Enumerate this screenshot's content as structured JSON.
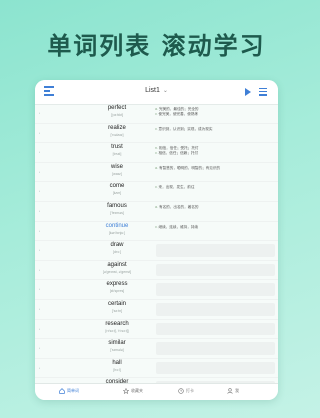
{
  "hero": {
    "title": "单词列表 滚动学习"
  },
  "toolbar": {
    "title": "List1",
    "chevron": "⌄"
  },
  "rows": [
    {
      "word": "perfect",
      "phonetic": "['pɜ:fɪkt]",
      "defs": [
        {
          "pos": "a.",
          "text": "完美的，最佳的；完全的"
        },
        {
          "pos": "v.",
          "text": "使完美，使完善，使熟练"
        }
      ]
    },
    {
      "word": "realize",
      "phonetic": "['rɪəlaɪz]",
      "defs": [
        {
          "pos": "v.",
          "text": "意识到，认识到；实现，成为现实"
        }
      ]
    },
    {
      "word": "trust",
      "phonetic": "[trʌst]",
      "defs": [
        {
          "pos": "n.",
          "text": "相信，信任；受托；托付"
        },
        {
          "pos": "v.",
          "text": "相信，信任；信赖；托付"
        }
      ]
    },
    {
      "word": "wise",
      "phonetic": "[waɪz]",
      "defs": [
        {
          "pos": "a.",
          "text": "有智慧的，聪明的，明智的；有见识的"
        }
      ]
    },
    {
      "word": "come",
      "phonetic": "[kʌm]",
      "defs": [
        {
          "pos": "v.",
          "text": "来，出现，发生，前往"
        }
      ]
    },
    {
      "word": "famous",
      "phonetic": "['feɪməs]",
      "defs": [
        {
          "pos": "a.",
          "text": "有名的，出名的，著名的"
        }
      ]
    },
    {
      "word": "continue",
      "phonetic": "[kən'tɪnju:]",
      "active": true,
      "defs": [
        {
          "pos": "v.",
          "text": "继续，连续，维持，持续"
        }
      ]
    },
    {
      "word": "draw",
      "phonetic": "[drɔ:]",
      "defs": []
    },
    {
      "word": "against",
      "phonetic": "[ə'geɪnst, ə'genst]",
      "defs": []
    },
    {
      "word": "express",
      "phonetic": "[ɪk'spres]",
      "defs": []
    },
    {
      "word": "certain",
      "phonetic": "['sɜ:tn]",
      "defs": []
    },
    {
      "word": "research",
      "phonetic": "[rɪ'sɜ:tʃ, 'ri:sɜ:tʃ]",
      "defs": []
    },
    {
      "word": "similar",
      "phonetic": "['sɪmələ]",
      "defs": []
    },
    {
      "word": "hall",
      "phonetic": "[hɔ:l]",
      "defs": []
    },
    {
      "word": "consider",
      "phonetic": "[kən'sɪdə]",
      "defs": []
    }
  ],
  "tabbar": {
    "items": [
      {
        "label": "简单词",
        "icon": "home-icon",
        "active": true
      },
      {
        "label": "收藏夹",
        "icon": "star-icon"
      },
      {
        "label": "打卡",
        "icon": "clock-icon"
      },
      {
        "label": "我",
        "icon": "person-icon"
      }
    ]
  },
  "colors": {
    "accent": "#3f7fd6",
    "hero_text": "#1e5a4d",
    "background": "#a6ecda"
  }
}
